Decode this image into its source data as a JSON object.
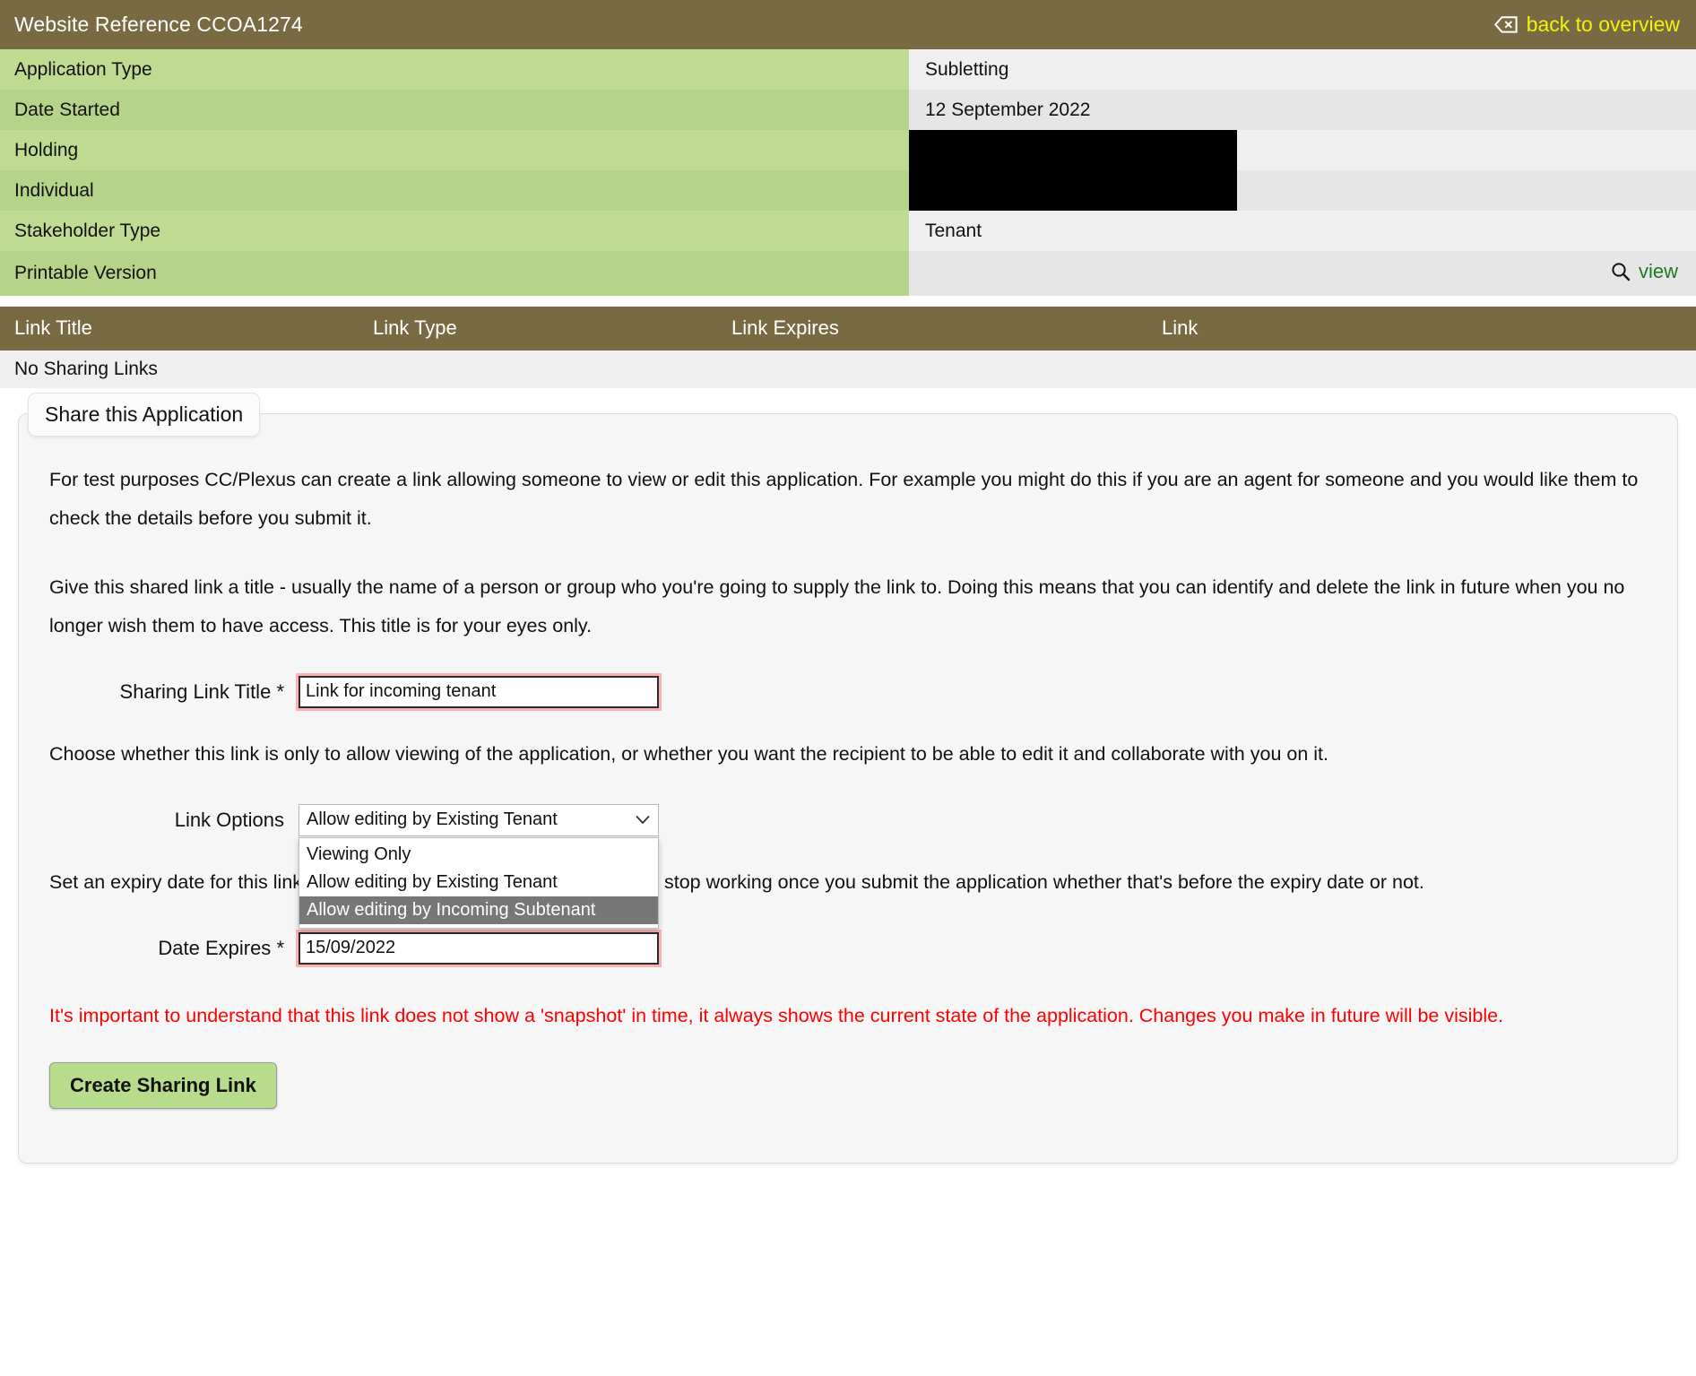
{
  "header": {
    "title": "Website Reference CCOA1274",
    "back_label": "back to overview",
    "back_icon": "backspace-icon",
    "bar_color": "#7a6a43",
    "link_color": "#f2f20a"
  },
  "details": {
    "rows": [
      {
        "label": "Application Type",
        "value": "Subletting",
        "redacted": false
      },
      {
        "label": "Date Started",
        "value": "12 September 2022",
        "redacted": false
      },
      {
        "label": "Holding",
        "value": "",
        "redacted": true
      },
      {
        "label": "Individual",
        "value": "",
        "redacted": true
      },
      {
        "label": "Stakeholder Type",
        "value": "Tenant",
        "redacted": false
      },
      {
        "label": "Printable Version",
        "value": "",
        "redacted": false,
        "action": "view",
        "action_icon": "search-icon"
      }
    ]
  },
  "sharing_links": {
    "columns": [
      "Link Title",
      "Link Type",
      "Link Expires",
      "Link"
    ],
    "empty_message": "No Sharing Links"
  },
  "share_panel": {
    "legend": "Share this Application",
    "intro_paragraph": "For test purposes CC/Plexus can create a link allowing someone to view or edit this application. For example you might do this if you are an agent for someone and you would like them to check the details before you submit it.",
    "title_paragraph": "Give this shared link a title - usually the name of a person or group who you're going to supply the link to. Doing this means that you can identify and delete the link in future when you no longer wish them to have access. This title is for your eyes only.",
    "sharing_link_title": {
      "label": "Sharing Link Title",
      "required_marker": "*",
      "value": "Link for incoming tenant"
    },
    "options_paragraph": "Choose whether this link is only to allow viewing of the application, or whether you want the recipient to be able to edit it and collaborate with you on it.",
    "link_options": {
      "label": "Link Options",
      "selected": "Allow editing by Existing Tenant",
      "expanded": true,
      "options": [
        "Viewing Only",
        "Allow editing by Existing Tenant",
        "Allow editing by Incoming Subtenant"
      ],
      "highlighted_option": "Allow editing by Incoming Subtenant",
      "chevron_icon": "chevron-down-icon"
    },
    "expiry_paragraph_start": "Set an expiry date for this link",
    "expiry_paragraph_end": "e link will stop working once you submit the application whether that's before the expiry date or not.",
    "date_expires": {
      "label": "Date Expires",
      "required_marker": "*",
      "value": "15/09/2022"
    },
    "warning": "It's important to understand that this link does not show a 'snapshot' in time, it always shows the current state of the application. Changes you make in future will be visible.",
    "warning_color": "#ff0000",
    "submit_label": "Create Sharing Link",
    "submit_color": "#b6dc8c"
  }
}
